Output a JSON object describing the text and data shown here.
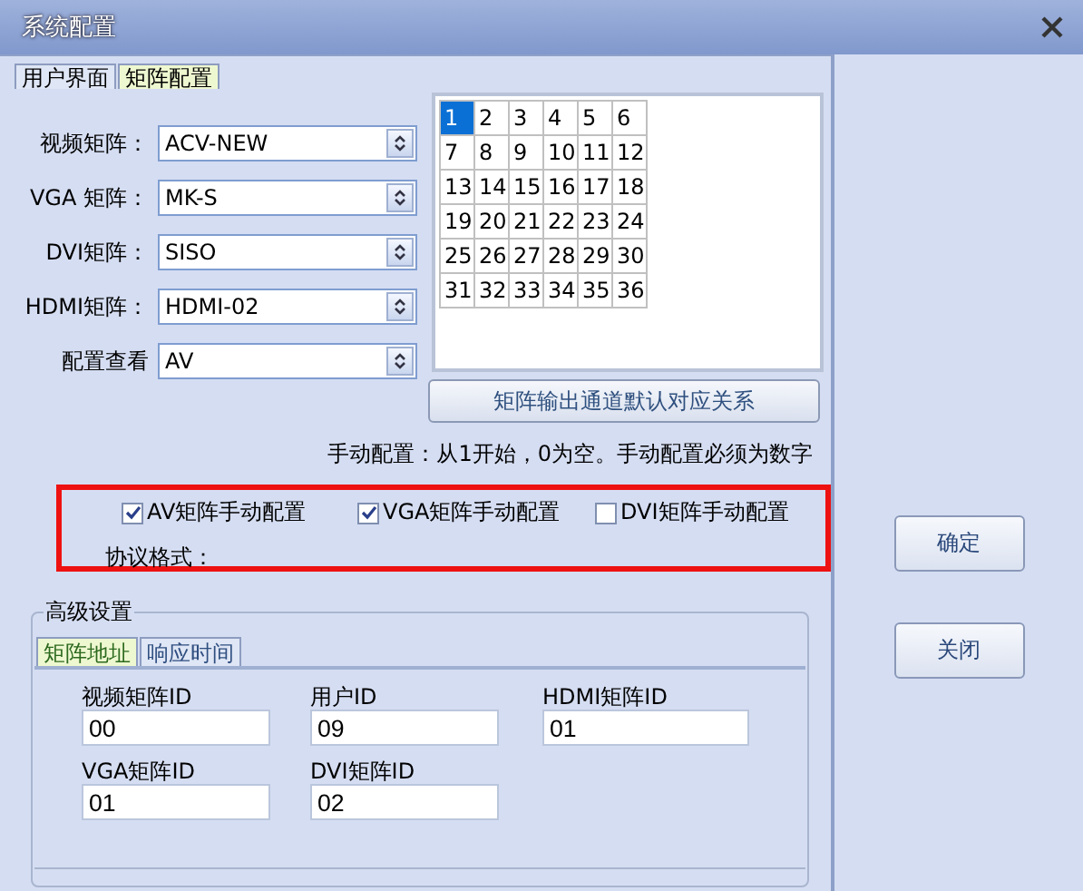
{
  "window": {
    "title": "系统配置"
  },
  "tabs": [
    {
      "label": "用户界面",
      "selected": false
    },
    {
      "label": "矩阵配置",
      "selected": true
    }
  ],
  "matrices": [
    {
      "label": "视频矩阵：",
      "value": "ACV-NEW"
    },
    {
      "label": "VGA 矩阵：",
      "value": "MK-S"
    },
    {
      "label": "DVI矩阵：",
      "value": "SISO"
    },
    {
      "label": "HDMI矩阵：",
      "value": "HDMI-02"
    },
    {
      "label": "配置查看",
      "value": "AV"
    }
  ],
  "channels": [
    {
      "text": "1",
      "selected": true
    },
    {
      "text": "2",
      "selected": false
    },
    {
      "text": "3",
      "selected": false
    },
    {
      "text": "4",
      "selected": false
    },
    {
      "text": "5",
      "selected": false
    },
    {
      "text": "6",
      "selected": false
    },
    {
      "text": "7",
      "selected": false
    },
    {
      "text": "8",
      "selected": false
    },
    {
      "text": "9",
      "selected": false
    },
    {
      "text": "10",
      "selected": false
    },
    {
      "text": "11",
      "selected": false
    },
    {
      "text": "12",
      "selected": false
    },
    {
      "text": "13",
      "selected": false
    },
    {
      "text": "14",
      "selected": false
    },
    {
      "text": "15",
      "selected": false
    },
    {
      "text": "16",
      "selected": false
    },
    {
      "text": "17",
      "selected": false
    },
    {
      "text": "18",
      "selected": false
    },
    {
      "text": "19",
      "selected": false
    },
    {
      "text": "20",
      "selected": false
    },
    {
      "text": "21",
      "selected": false
    },
    {
      "text": "22",
      "selected": false
    },
    {
      "text": "23",
      "selected": false
    },
    {
      "text": "24",
      "selected": false
    },
    {
      "text": "25",
      "selected": false
    },
    {
      "text": "26",
      "selected": false
    },
    {
      "text": "27",
      "selected": false
    },
    {
      "text": "28",
      "selected": false
    },
    {
      "text": "29",
      "selected": false
    },
    {
      "text": "30",
      "selected": false
    },
    {
      "text": "31",
      "selected": false
    },
    {
      "text": "32",
      "selected": false
    },
    {
      "text": "33",
      "selected": false
    },
    {
      "text": "34",
      "selected": false
    },
    {
      "text": "35",
      "selected": false
    },
    {
      "text": "36",
      "selected": false
    }
  ],
  "mapping_button": "矩阵输出通道默认对应关系",
  "hint": "手动配置：从1开始，0为空。手动配置必须为数字",
  "manual_config": {
    "highlighted": true,
    "checkboxes": [
      {
        "label": "AV矩阵手动配置",
        "checked": true
      },
      {
        "label": "VGA矩阵手动配置",
        "checked": true
      },
      {
        "label": "DVI矩阵手动配置",
        "checked": false
      }
    ],
    "protocol_label": "协议格式："
  },
  "advanced": {
    "title": "高级设置",
    "tabs": [
      {
        "label": "矩阵地址",
        "selected": true
      },
      {
        "label": "响应时间",
        "selected": false
      }
    ],
    "fields": [
      {
        "label": "视频矩阵ID",
        "value": "00"
      },
      {
        "label": "用户ID",
        "value": "09"
      },
      {
        "label": "HDMI矩阵ID",
        "value": "01"
      },
      {
        "label": "VGA矩阵ID",
        "value": "01"
      },
      {
        "label": "DVI矩阵ID",
        "value": "02"
      }
    ]
  },
  "buttons": [
    "确定",
    "关闭"
  ]
}
